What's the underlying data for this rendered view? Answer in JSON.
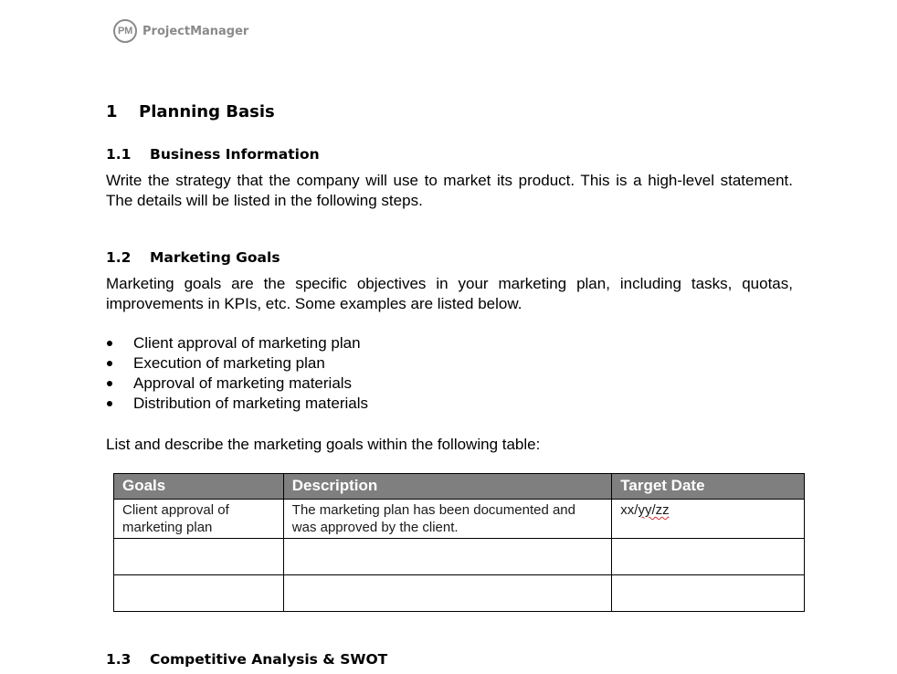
{
  "brand": {
    "logo_initials": "PM",
    "logo_name": "ProjectManager"
  },
  "section_1": {
    "number": "1",
    "title": "Planning Basis"
  },
  "section_1_1": {
    "number": "1.1",
    "title": "Business Information",
    "body": "Write the strategy that the company will use to market its product. This is a high-level statement. The details will be listed in the following steps."
  },
  "section_1_2": {
    "number": "1.2",
    "title": "Marketing Goals",
    "body": "Marketing goals are the specific objectives in your marketing plan, including tasks, quotas, improvements in KPIs, etc. Some examples are listed below.",
    "bullets": [
      "Client approval of marketing plan",
      "Execution of marketing plan",
      "Approval of marketing materials",
      "Distribution of marketing materials"
    ],
    "table_intro": "List and describe the marketing goals within the following table:",
    "table": {
      "headers": [
        "Goals",
        "Description",
        "Target Date"
      ],
      "rows": [
        [
          "Client approval of marketing plan",
          "The marketing plan has been documented and was approved by the client.",
          "xx/yy/zz"
        ],
        [
          "",
          "",
          ""
        ],
        [
          "",
          "",
          ""
        ]
      ],
      "date_prefix": "xx/",
      "date_suffix": "yy/zz"
    },
    "header_color": "#7f7f7f"
  },
  "section_1_3": {
    "number": "1.3",
    "title": "Competitive Analysis & SWOT"
  }
}
